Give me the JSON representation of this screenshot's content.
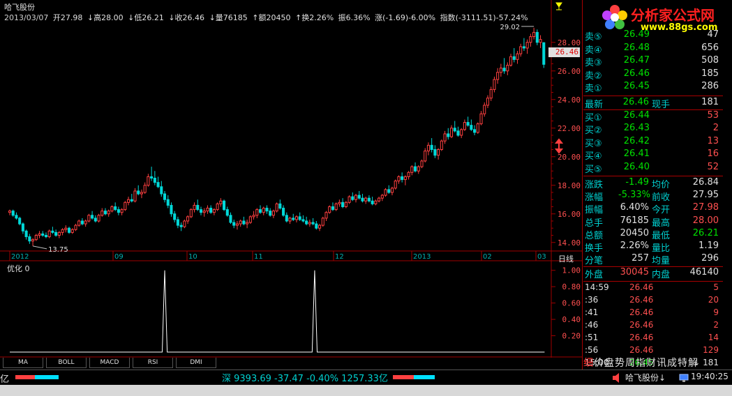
{
  "stock": {
    "name": "哈飞股份"
  },
  "info_bar": {
    "date": "2013/03/07",
    "open": "开27.98",
    "high": "↓高28.00",
    "low": "↓低26.21",
    "close": "↓收26.46",
    "volume": "↓量76185",
    "amount": "↑额20450",
    "turnover": "↑换2.26%",
    "amplitude": "振6.36%",
    "change": "涨(-1.69)-6.00%",
    "index": "指数(-3111.51)-57.24%"
  },
  "price_axis": [
    "28.00",
    "26.00",
    "24.00",
    "22.00",
    "20.00",
    "18.00",
    "16.00",
    "14.00"
  ],
  "indicator_axis": [
    "1.00",
    "0.80",
    "0.60",
    "0.40",
    "0.20"
  ],
  "date_axis": [
    "2012",
    "09",
    "10",
    "11",
    "12",
    "2013",
    "02",
    "03"
  ],
  "period_label": "日线",
  "current_price_tag": "26.46",
  "high_annotation": "29.02",
  "low_annotation": "13.75",
  "indicator_name": "优化 0",
  "tabs": [
    "MA",
    "BOLL",
    "MACD",
    "RSI",
    "DMI"
  ],
  "colors": {
    "up": "#ff5050",
    "down": "#00d0d0",
    "axis": "#a00000",
    "accent": "#ffff00"
  },
  "chart_data": {
    "type": "candlestick",
    "ylim": [
      13.5,
      29.5
    ],
    "indicator": {
      "name": "优化",
      "value": 0,
      "ylim": [
        0,
        1.1
      ],
      "spikes_at_index": [
        62,
        122
      ],
      "spike_value": 1.0,
      "length": 215
    },
    "ohlc": [
      [
        16.1,
        16.3,
        15.9,
        16.2
      ],
      [
        16.2,
        16.3,
        15.8,
        15.9
      ],
      [
        15.9,
        16.1,
        15.6,
        15.7
      ],
      [
        15.7,
        15.8,
        15.2,
        15.3
      ],
      [
        15.3,
        15.4,
        14.6,
        14.8
      ],
      [
        14.8,
        14.9,
        14.2,
        14.4
      ],
      [
        14.4,
        14.6,
        13.9,
        14.1
      ],
      [
        14.1,
        14.3,
        13.75,
        14.2
      ],
      [
        14.2,
        14.6,
        14.1,
        14.5
      ],
      [
        14.5,
        14.8,
        14.3,
        14.6
      ],
      [
        14.6,
        14.8,
        14.4,
        14.5
      ],
      [
        14.5,
        14.7,
        14.3,
        14.4
      ],
      [
        14.4,
        14.9,
        14.3,
        14.8
      ],
      [
        14.8,
        15.1,
        14.6,
        14.7
      ],
      [
        14.7,
        14.9,
        14.4,
        14.5
      ],
      [
        14.5,
        14.8,
        14.3,
        14.7
      ],
      [
        14.7,
        15.0,
        14.5,
        14.9
      ],
      [
        14.9,
        15.2,
        14.7,
        15.0
      ],
      [
        15.0,
        15.1,
        14.6,
        14.7
      ],
      [
        14.7,
        15.0,
        14.6,
        14.9
      ],
      [
        14.9,
        15.3,
        14.8,
        15.2
      ],
      [
        15.2,
        15.6,
        15.1,
        15.5
      ],
      [
        15.5,
        15.7,
        15.2,
        15.3
      ],
      [
        15.3,
        15.6,
        15.1,
        15.5
      ],
      [
        15.5,
        16.0,
        15.4,
        15.9
      ],
      [
        15.9,
        16.2,
        15.6,
        15.7
      ],
      [
        15.7,
        15.9,
        15.4,
        15.5
      ],
      [
        15.5,
        16.0,
        15.4,
        15.9
      ],
      [
        15.9,
        16.4,
        15.8,
        16.2
      ],
      [
        16.2,
        16.4,
        15.9,
        16.0
      ],
      [
        16.0,
        16.3,
        15.8,
        16.2
      ],
      [
        16.2,
        16.6,
        16.1,
        16.5
      ],
      [
        16.5,
        16.8,
        16.2,
        16.3
      ],
      [
        16.3,
        16.5,
        15.9,
        16.1
      ],
      [
        16.1,
        16.4,
        15.9,
        16.3
      ],
      [
        16.3,
        16.9,
        16.2,
        16.8
      ],
      [
        16.8,
        17.2,
        16.6,
        17.0
      ],
      [
        17.0,
        17.4,
        16.8,
        16.9
      ],
      [
        16.9,
        17.8,
        16.8,
        17.6
      ],
      [
        17.6,
        18.0,
        17.3,
        17.4
      ],
      [
        17.4,
        17.7,
        17.1,
        17.5
      ],
      [
        17.5,
        18.2,
        17.4,
        18.0
      ],
      [
        18.0,
        18.8,
        17.9,
        18.6
      ],
      [
        18.6,
        19.3,
        18.3,
        18.5
      ],
      [
        18.5,
        19.0,
        18.0,
        18.2
      ],
      [
        18.2,
        18.6,
        17.8,
        17.9
      ],
      [
        17.9,
        18.3,
        17.2,
        17.4
      ],
      [
        17.4,
        17.6,
        16.8,
        17.0
      ],
      [
        17.0,
        17.3,
        16.4,
        16.6
      ],
      [
        16.6,
        16.8,
        15.8,
        16.0
      ],
      [
        16.0,
        16.2,
        15.4,
        15.6
      ],
      [
        15.6,
        15.8,
        15.0,
        15.2
      ],
      [
        15.2,
        15.4,
        14.8,
        15.1
      ],
      [
        15.1,
        15.6,
        15.0,
        15.5
      ],
      [
        15.5,
        15.9,
        15.3,
        15.8
      ],
      [
        15.8,
        16.4,
        15.7,
        16.3
      ],
      [
        16.3,
        16.8,
        16.1,
        16.6
      ],
      [
        16.6,
        17.0,
        16.2,
        16.3
      ],
      [
        16.3,
        16.5,
        15.9,
        16.1
      ],
      [
        16.1,
        16.4,
        15.8,
        16.2
      ],
      [
        16.2,
        16.6,
        16.0,
        16.4
      ],
      [
        16.4,
        16.6,
        16.0,
        16.1
      ],
      [
        16.1,
        16.4,
        15.9,
        16.3
      ],
      [
        16.3,
        16.8,
        16.2,
        16.7
      ],
      [
        16.7,
        17.1,
        16.5,
        16.9
      ],
      [
        16.9,
        17.0,
        16.2,
        16.3
      ],
      [
        16.3,
        16.5,
        15.8,
        15.9
      ],
      [
        15.9,
        16.1,
        15.3,
        15.4
      ],
      [
        15.4,
        15.6,
        15.0,
        15.2
      ],
      [
        15.2,
        15.5,
        14.9,
        15.3
      ],
      [
        15.3,
        15.6,
        15.1,
        15.5
      ],
      [
        15.5,
        15.8,
        15.2,
        15.3
      ],
      [
        15.3,
        15.6,
        15.0,
        15.4
      ],
      [
        15.4,
        15.9,
        15.3,
        15.8
      ],
      [
        15.8,
        16.2,
        15.6,
        15.9
      ],
      [
        15.9,
        16.4,
        15.7,
        16.3
      ],
      [
        16.3,
        16.6,
        16.0,
        16.1
      ],
      [
        16.1,
        16.5,
        15.9,
        16.4
      ],
      [
        16.4,
        16.6,
        16.0,
        16.2
      ],
      [
        16.2,
        16.4,
        15.8,
        15.9
      ],
      [
        15.9,
        16.3,
        15.7,
        16.2
      ],
      [
        16.2,
        16.8,
        16.1,
        16.7
      ],
      [
        16.7,
        17.0,
        16.3,
        16.4
      ],
      [
        16.4,
        16.6,
        15.8,
        15.9
      ],
      [
        15.9,
        16.1,
        15.4,
        15.5
      ],
      [
        15.5,
        15.8,
        15.3,
        15.7
      ],
      [
        15.7,
        16.0,
        15.5,
        15.6
      ],
      [
        15.6,
        15.9,
        15.4,
        15.8
      ],
      [
        15.8,
        16.1,
        15.5,
        15.6
      ],
      [
        15.6,
        15.9,
        15.4,
        15.5
      ],
      [
        15.5,
        15.8,
        15.2,
        15.3
      ],
      [
        15.3,
        15.6,
        15.1,
        15.4
      ],
      [
        15.4,
        15.7,
        15.2,
        15.3
      ],
      [
        15.3,
        15.5,
        14.9,
        15.0
      ],
      [
        15.0,
        15.3,
        14.8,
        15.2
      ],
      [
        15.2,
        15.8,
        15.1,
        15.7
      ],
      [
        15.7,
        16.2,
        15.5,
        16.1
      ],
      [
        16.1,
        16.6,
        16.0,
        16.5
      ],
      [
        16.5,
        16.8,
        16.2,
        16.3
      ],
      [
        16.3,
        16.8,
        16.2,
        16.7
      ],
      [
        16.7,
        17.0,
        16.5,
        16.8
      ],
      [
        16.8,
        17.1,
        16.4,
        16.5
      ],
      [
        16.5,
        16.9,
        16.4,
        16.8
      ],
      [
        16.8,
        17.3,
        16.7,
        17.2
      ],
      [
        17.2,
        17.5,
        16.9,
        17.0
      ],
      [
        17.0,
        17.4,
        16.8,
        17.3
      ],
      [
        17.3,
        17.6,
        17.0,
        17.1
      ],
      [
        17.1,
        17.4,
        16.8,
        16.9
      ],
      [
        16.9,
        17.2,
        16.7,
        17.1
      ],
      [
        17.1,
        17.3,
        16.8,
        16.9
      ],
      [
        16.9,
        17.2,
        16.6,
        16.7
      ],
      [
        16.7,
        17.0,
        16.6,
        16.9
      ],
      [
        16.9,
        17.2,
        16.8,
        17.1
      ],
      [
        17.1,
        17.4,
        16.9,
        17.3
      ],
      [
        17.3,
        17.8,
        17.2,
        17.7
      ],
      [
        17.7,
        18.0,
        17.4,
        17.5
      ],
      [
        17.5,
        17.9,
        17.3,
        17.8
      ],
      [
        17.8,
        18.4,
        17.7,
        18.3
      ],
      [
        18.3,
        18.7,
        18.1,
        18.6
      ],
      [
        18.6,
        18.9,
        18.2,
        18.4
      ],
      [
        18.4,
        18.7,
        18.0,
        18.6
      ],
      [
        18.6,
        19.0,
        18.4,
        18.9
      ],
      [
        18.9,
        19.4,
        18.7,
        19.3
      ],
      [
        19.3,
        19.6,
        18.9,
        19.0
      ],
      [
        19.0,
        19.4,
        18.8,
        19.3
      ],
      [
        19.3,
        19.8,
        19.2,
        19.7
      ],
      [
        19.7,
        20.6,
        19.6,
        20.4
      ],
      [
        20.4,
        21.0,
        20.1,
        20.8
      ],
      [
        20.8,
        21.3,
        20.3,
        20.5
      ],
      [
        20.5,
        20.8,
        19.9,
        20.1
      ],
      [
        20.1,
        20.6,
        19.8,
        20.5
      ],
      [
        20.5,
        21.2,
        20.4,
        21.1
      ],
      [
        21.1,
        21.8,
        20.9,
        21.6
      ],
      [
        21.6,
        22.0,
        21.2,
        21.4
      ],
      [
        21.4,
        22.2,
        21.3,
        22.0
      ],
      [
        22.0,
        22.5,
        21.7,
        21.8
      ],
      [
        21.8,
        22.1,
        21.4,
        21.5
      ],
      [
        21.5,
        22.0,
        21.3,
        21.9
      ],
      [
        21.9,
        22.6,
        21.8,
        22.4
      ],
      [
        22.4,
        22.8,
        22.1,
        22.2
      ],
      [
        22.2,
        22.6,
        21.8,
        21.9
      ],
      [
        21.9,
        22.2,
        21.5,
        21.7
      ],
      [
        21.7,
        22.4,
        21.6,
        22.3
      ],
      [
        22.3,
        23.2,
        22.2,
        23.0
      ],
      [
        23.0,
        23.8,
        22.8,
        23.6
      ],
      [
        23.6,
        24.3,
        23.4,
        24.1
      ],
      [
        24.1,
        24.9,
        23.9,
        24.7
      ],
      [
        24.7,
        25.6,
        24.5,
        25.4
      ],
      [
        25.4,
        26.2,
        25.1,
        25.9
      ],
      [
        25.9,
        26.5,
        25.6,
        26.2
      ],
      [
        26.2,
        26.9,
        25.8,
        26.0
      ],
      [
        26.0,
        26.6,
        25.7,
        26.4
      ],
      [
        26.4,
        27.2,
        26.3,
        27.0
      ],
      [
        27.0,
        27.6,
        26.6,
        26.8
      ],
      [
        26.8,
        27.4,
        26.5,
        27.2
      ],
      [
        27.2,
        27.9,
        27.0,
        27.7
      ],
      [
        27.7,
        28.3,
        27.4,
        27.6
      ],
      [
        27.6,
        28.2,
        27.2,
        28.0
      ],
      [
        28.0,
        28.6,
        27.7,
        28.4
      ],
      [
        28.4,
        29.02,
        28.2,
        28.7
      ],
      [
        28.7,
        28.9,
        27.8,
        28.0
      ],
      [
        28.0,
        28.5,
        27.6,
        28.2
      ],
      [
        27.98,
        28.0,
        26.21,
        26.46
      ]
    ]
  },
  "quote_panel": {
    "sell": [
      {
        "label": "卖⑤",
        "price": "26.49",
        "vol": "47"
      },
      {
        "label": "卖④",
        "price": "26.48",
        "vol": "656"
      },
      {
        "label": "卖③",
        "price": "26.47",
        "vol": "508"
      },
      {
        "label": "卖②",
        "price": "26.46",
        "vol": "185"
      },
      {
        "label": "卖①",
        "price": "26.45",
        "vol": "286"
      }
    ],
    "latest": {
      "label": "最新",
      "price": "26.46",
      "label2": "现手",
      "vol": "181"
    },
    "buy": [
      {
        "label": "买①",
        "price": "26.44",
        "vol": "53"
      },
      {
        "label": "买②",
        "price": "26.43",
        "vol": "2"
      },
      {
        "label": "买③",
        "price": "26.42",
        "vol": "13"
      },
      {
        "label": "买④",
        "price": "26.41",
        "vol": "16"
      },
      {
        "label": "买⑤",
        "price": "26.40",
        "vol": "52"
      }
    ],
    "stats": [
      {
        "k1": "涨跌",
        "v1": "-1.49",
        "k2": "均价",
        "v2": "26.84"
      },
      {
        "k1": "涨幅",
        "v1": "-5.33%",
        "k2": "前收",
        "v2": "27.95"
      },
      {
        "k1": "振幅",
        "v1": "6.40%",
        "k2": "今开",
        "v2": "27.98"
      },
      {
        "k1": "总手",
        "v1": "76185",
        "k2": "最高",
        "v2": "28.00"
      },
      {
        "k1": "总额",
        "v1": "20450",
        "k2": "最低",
        "v2": "26.21"
      },
      {
        "k1": "换手",
        "v1": "2.26%",
        "k2": "量比",
        "v2": "1.19"
      },
      {
        "k1": "分笔",
        "v1": "257",
        "k2": "均量",
        "v2": "296"
      }
    ],
    "outer_inner": {
      "k1": "外盘",
      "v1": "30045",
      "k2": "内盘",
      "v2": "46140"
    },
    "ticks": [
      {
        "time": "14:59",
        "price": "26.46",
        "vol": "5"
      },
      {
        "time": ":36",
        "price": "26.46",
        "vol": "20"
      },
      {
        "time": ":41",
        "price": "26.46",
        "vol": "9"
      },
      {
        "time": ":46",
        "price": "26.46",
        "vol": "2"
      },
      {
        "time": ":51",
        "price": "26.46",
        "vol": "14"
      },
      {
        "time": ":56",
        "price": "26.46",
        "vol": "129"
      },
      {
        "time": "15:00",
        "price": "26.45",
        "vol": "↓ 181"
      }
    ]
  },
  "logo": {
    "text": "分析家公式网",
    "url": "www.88gs.com"
  },
  "function_bar": [
    "细",
    "价",
    "盘",
    "势",
    "周",
    "指",
    "财",
    "讯",
    "成",
    "特",
    "解"
  ],
  "status_bar": {
    "left": "亿",
    "index_text": "深 9393.69 -37.47 -0.40% 1257.33亿",
    "stock": "哈飞股份↓",
    "time": "19:40:25"
  }
}
